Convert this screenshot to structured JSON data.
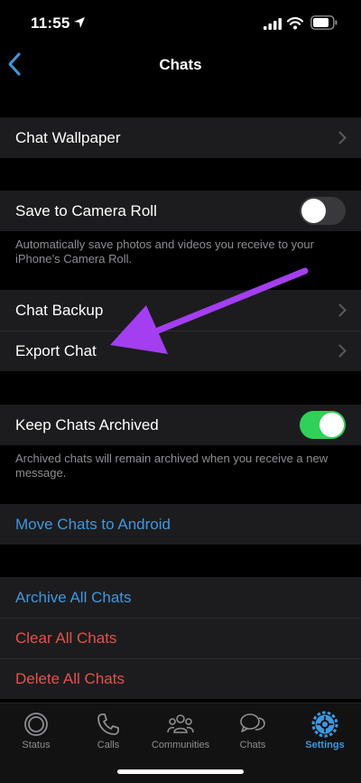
{
  "status_bar": {
    "time": "11:55"
  },
  "nav": {
    "title": "Chats"
  },
  "wallpaper": {
    "label": "Chat Wallpaper"
  },
  "camera_roll": {
    "label": "Save to Camera Roll",
    "enabled": false,
    "footnote": "Automatically save photos and videos you receive to your iPhone’s Camera Roll."
  },
  "backup": {
    "chat_backup": "Chat Backup",
    "export_chat": "Export Chat"
  },
  "archived": {
    "label": "Keep Chats Archived",
    "enabled": true,
    "footnote": "Archived chats will remain archived when you receive a new message."
  },
  "move": {
    "label": "Move Chats to Android"
  },
  "actions": {
    "archive_all": "Archive All Chats",
    "clear_all": "Clear All Chats",
    "delete_all": "Delete All Chats"
  },
  "tabs": [
    {
      "label": "Status",
      "icon": "status-icon",
      "active": false
    },
    {
      "label": "Calls",
      "icon": "phone-icon",
      "active": false
    },
    {
      "label": "Communities",
      "icon": "communities-icon",
      "active": false
    },
    {
      "label": "Chats",
      "icon": "chats-icon",
      "active": false
    },
    {
      "label": "Settings",
      "icon": "gear-icon",
      "active": true
    }
  ],
  "colors": {
    "accent_blue": "#3e98e0",
    "destructive_red": "#e8504a",
    "toggle_on": "#30d158",
    "annotation_arrow": "#a33ff0"
  }
}
